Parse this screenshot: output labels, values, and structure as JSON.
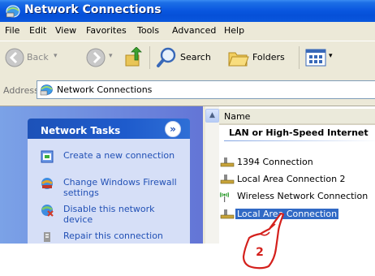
{
  "window": {
    "title": "Network Connections"
  },
  "menu": [
    "File",
    "Edit",
    "View",
    "Favorites",
    "Tools",
    "Advanced",
    "Help"
  ],
  "toolbar": {
    "back": "Back",
    "search": "Search",
    "folders": "Folders"
  },
  "address": {
    "label": "Address",
    "value": "Network Connections"
  },
  "tasks": {
    "title": "Network Tasks",
    "collapse_glyph": "»",
    "items": [
      {
        "label": "Create a new connection",
        "icon": "new-connection-icon"
      },
      {
        "label": "Change Windows Firewall settings",
        "icon": "firewall-icon"
      },
      {
        "label": "Disable this network device",
        "icon": "disable-device-icon"
      },
      {
        "label": "Repair this connection",
        "icon": "repair-icon"
      }
    ]
  },
  "list": {
    "column_name": "Name",
    "group_title": "LAN or High-Speed Internet",
    "items": [
      {
        "label": "1394 Connection",
        "icon": "network-plug-icon",
        "selected": false
      },
      {
        "label": "Local Area Connection 2",
        "icon": "network-plug-icon",
        "selected": false
      },
      {
        "label": "Wireless Network Connection",
        "icon": "wireless-icon",
        "selected": false
      },
      {
        "label": "Local Area Connection",
        "icon": "network-plug-icon",
        "selected": true
      }
    ]
  },
  "annotation": {
    "step": "2"
  },
  "colors": {
    "title_blue": "#0a58e0",
    "selection": "#316ac5",
    "link_blue": "#2150b5",
    "pane_blue": "#6375d6"
  }
}
